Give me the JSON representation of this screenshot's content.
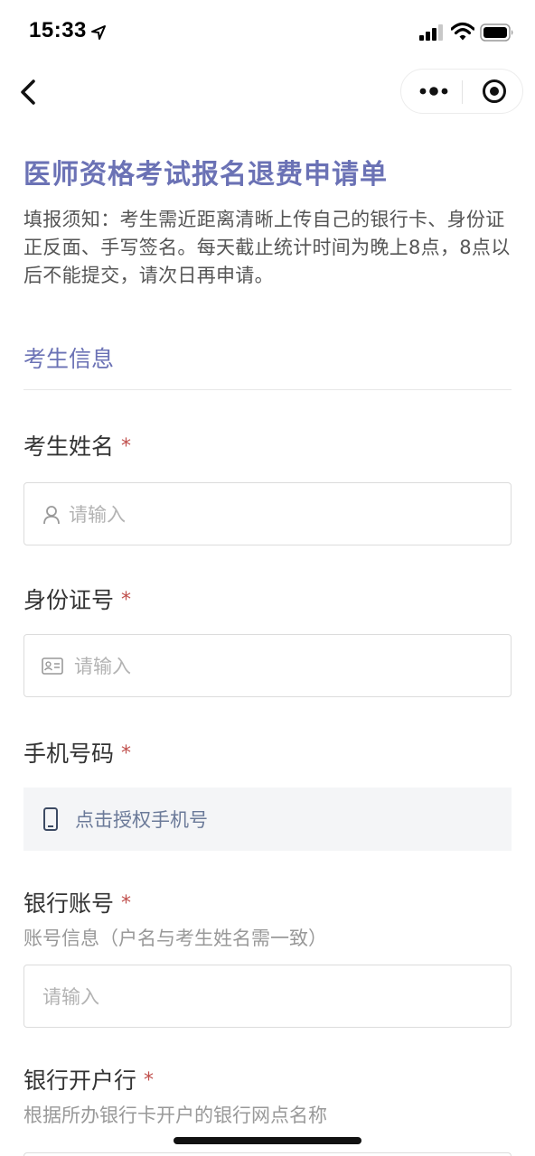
{
  "status_bar": {
    "time": "15:33"
  },
  "form": {
    "title": "医师资格考试报名退费申请单",
    "notice": "填报须知：考生需近距离清晰上传自己的银行卡、身份证正反面、手写签名。每天截止统计时间为晚上8点，8点以后不能提交，请次日再申请。",
    "section_title": "考生信息",
    "required_mark": "*",
    "fields": {
      "name": {
        "label": "考生姓名",
        "placeholder": "请输入",
        "icon": "person-icon"
      },
      "id_number": {
        "label": "身份证号",
        "placeholder": "请输入",
        "icon": "id-card-icon"
      },
      "phone": {
        "label": "手机号码",
        "button_label": "点击授权手机号",
        "icon": "mobile-phone-icon"
      },
      "bank_account": {
        "label": "银行账号",
        "hint": "账号信息（户名与考生姓名需一致）",
        "placeholder": "请输入"
      },
      "bank_branch": {
        "label": "银行开户行",
        "hint": "根据所办银行卡开户的银行网点名称"
      }
    }
  },
  "colors": {
    "accent": "#6b72b5",
    "required": "#c0504d",
    "placeholder": "#b3b3b3",
    "phone_auth_bg": "#f4f5f7"
  }
}
